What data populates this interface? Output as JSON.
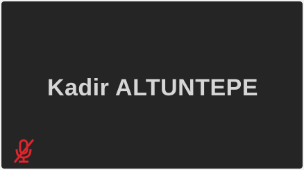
{
  "participant": {
    "name": "Kadir ALTUNTEPE",
    "mic_status_icon": "microphone-muted-icon"
  },
  "colors": {
    "tile_background": "#252525",
    "name_text": "#d6d6d6",
    "muted_indicator": "#e0242c"
  }
}
